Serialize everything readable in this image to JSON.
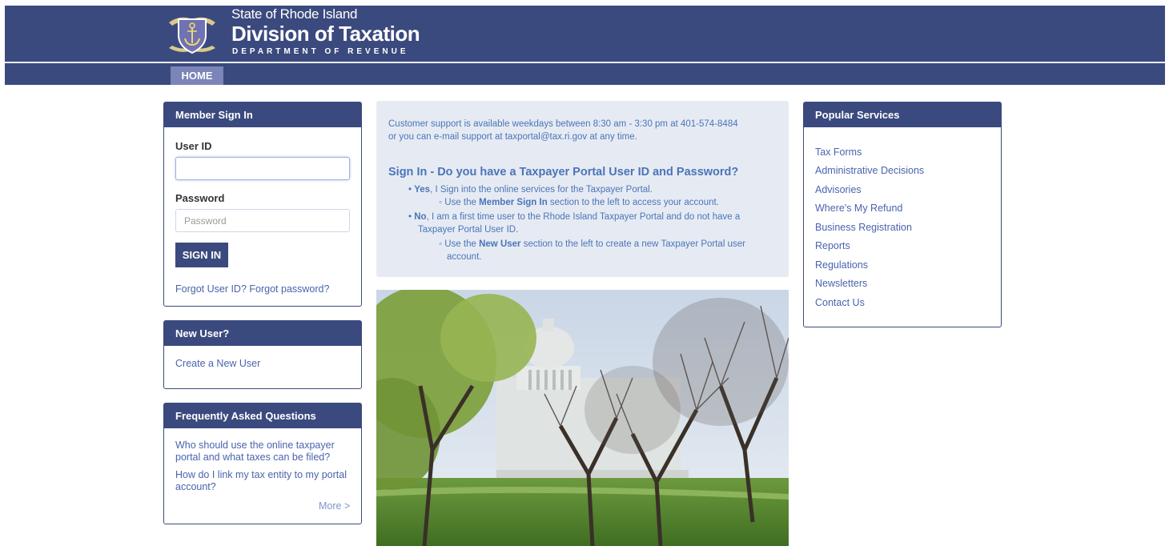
{
  "header": {
    "line1": "State of Rhode Island",
    "line2": "Division of Taxation",
    "line3": "DEPARTMENT OF REVENUE",
    "seal_icon": "rhode-island-seal-icon",
    "colors": {
      "primary": "#3b4a7e",
      "nav_active": "#7b85b8",
      "link": "#4a63ad",
      "info_bg": "#e6ebf3"
    }
  },
  "nav": {
    "home": "HOME"
  },
  "signin": {
    "title": "Member Sign In",
    "user_label": "User ID",
    "user_value": "",
    "pass_label": "Password",
    "pass_placeholder": "Password",
    "button": "SIGN IN",
    "forgot": "Forgot User ID? Forgot password?"
  },
  "new_user": {
    "title": "New User?",
    "link": "Create a New User"
  },
  "faq": {
    "title": "Frequently Asked Questions",
    "q1_line1": "Who should use the online taxpayer",
    "q1_line2": "portal and what taxes can be filed?",
    "q2_line1": "How do I link my tax entity to my portal",
    "q2_line2": "account?",
    "more": "More >"
  },
  "info": {
    "support_line1": "Customer support is available weekdays between 8:30 am - 3:30 pm at 401-574-8484",
    "support_line2": "or you can e-mail support at taxportal@tax.ri.gov at any time.",
    "heading": "Sign In - Do you have a Taxpayer Portal User ID and Password?",
    "yes_bold": "Yes",
    "yes_rest": ", I Sign into the online services for the Taxpayer Portal.",
    "yes_sub_pre": "Use the ",
    "yes_sub_bold": "Member Sign In",
    "yes_sub_post": " section to the left to access your account.",
    "no_bold": "No",
    "no_rest_line1": ", I am a first time user to the Rhode Island Taxpayer Portal and do not have a",
    "no_rest_line2": "Taxpayer Portal User ID.",
    "no_sub_pre": "Use the ",
    "no_sub_bold": "New User",
    "no_sub_post_line1": " section to the left to create a new Taxpayer Portal user",
    "no_sub_post_line2": "account."
  },
  "services": {
    "title": "Popular Services",
    "items": [
      "Tax Forms",
      "Administrative Decisions",
      "Advisories",
      "Where's My Refund",
      "Business Registration",
      "Reports",
      "Regulations",
      "Newsletters",
      "Contact Us"
    ]
  }
}
